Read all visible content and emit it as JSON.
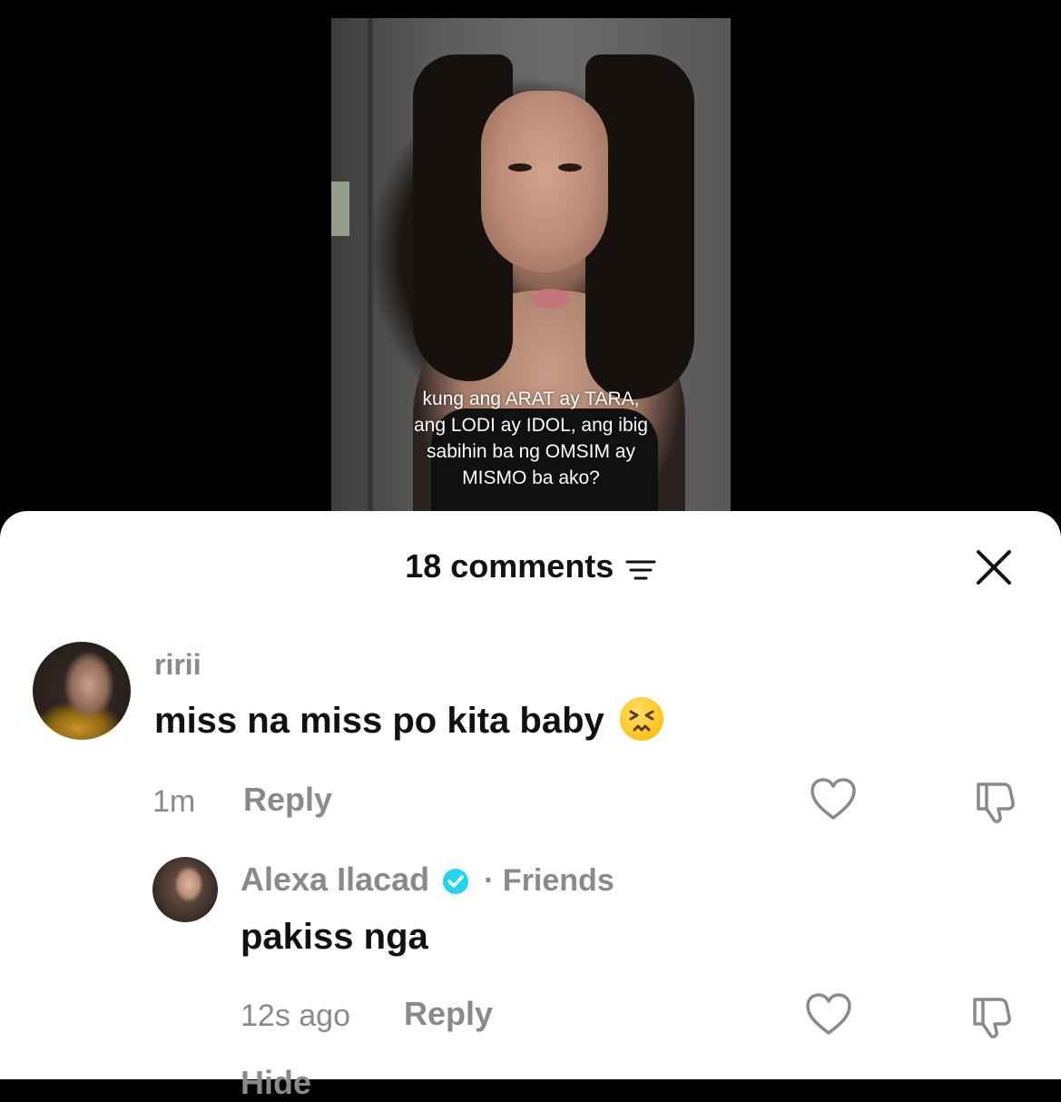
{
  "video": {
    "caption_lines": [
      "kung ang ARAT ay TARA,",
      "ang LODI ay IDOL, ang ibig",
      "sabihin ba ng OMSIM ay",
      "MISMO ba ako?"
    ]
  },
  "comments_sheet": {
    "title": "18 comments",
    "filter_icon": "filter-lines-icon",
    "close_icon": "close-icon"
  },
  "comments": [
    {
      "username": "ririi",
      "text": "miss na miss po kita baby",
      "emoji": "persevering-face",
      "time": "1m",
      "reply_label": "Reply"
    }
  ],
  "replies": [
    {
      "username": "Alexa Ilacad",
      "verified": true,
      "relation": "· Friends",
      "text": "pakiss nga",
      "time": "12s ago",
      "reply_label": "Reply",
      "partial_text": "Hide"
    }
  ],
  "colors": {
    "sheet_bg": "#ffffff",
    "secondary_text": "#8a8a8a",
    "primary_text": "#111111",
    "verified_blue": "#20d5ec"
  }
}
